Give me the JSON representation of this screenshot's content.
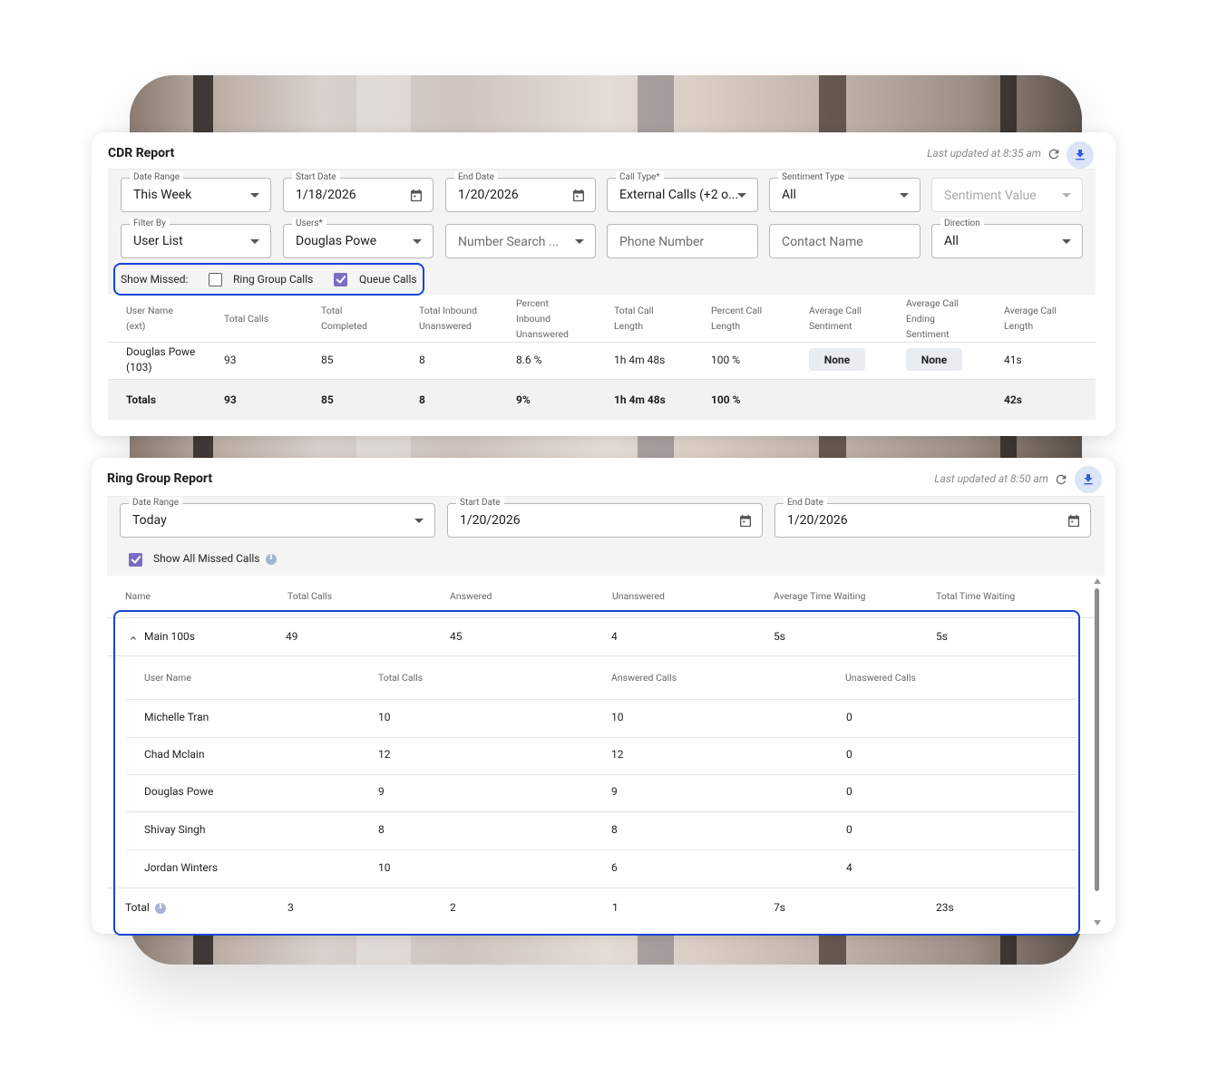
{
  "cdr": {
    "title": "CDR Report",
    "last_updated": "Last updated at 8:35 am",
    "filters": {
      "date_range": {
        "label": "Date Range",
        "value": "This Week"
      },
      "start_date": {
        "label": "Start Date",
        "value": "1/18/2026"
      },
      "end_date": {
        "label": "End Date",
        "value": "1/20/2026"
      },
      "call_type": {
        "label": "Call Type*",
        "value": "External Calls (+2 o..."
      },
      "sentiment_type": {
        "label": "Sentiment Type",
        "value": "All"
      },
      "sentiment_value": {
        "placeholder": "Sentiment Value"
      },
      "filter_by": {
        "label": "Filter By",
        "value": "User List"
      },
      "users": {
        "label": "Users*",
        "value": "Douglas Powe"
      },
      "number_search": {
        "placeholder": "Number Search ..."
      },
      "phone_number": {
        "placeholder": "Phone Number"
      },
      "contact_name": {
        "placeholder": "Contact Name"
      },
      "direction": {
        "label": "Direction",
        "value": "All"
      }
    },
    "show_missed": {
      "label": "Show Missed:",
      "ring_group_calls": {
        "label": "Ring Group Calls",
        "checked": false
      },
      "queue_calls": {
        "label": "Queue Calls",
        "checked": true
      }
    },
    "columns": [
      [
        "User Name",
        "(ext)"
      ],
      [
        "Total Calls"
      ],
      [
        "Total",
        "Completed"
      ],
      [
        "Total Inbound",
        "Unanswered"
      ],
      [
        "Percent",
        "Inbound",
        "Unanswered"
      ],
      [
        "Total Call",
        "Length"
      ],
      [
        "Percent Call",
        "Length"
      ],
      [
        "Average Call",
        "Sentiment"
      ],
      [
        "Average Call",
        "Ending",
        "Sentiment"
      ],
      [
        "Average Call",
        "Length"
      ]
    ],
    "row": {
      "user_name": "Douglas Powe",
      "ext": "(103)",
      "total_calls": "93",
      "total_completed": "85",
      "inbound_unanswered": "8",
      "percent_inbound_unanswered": "8.6 %",
      "total_call_length": "1h 4m 48s",
      "percent_call_length": "100 %",
      "avg_sentiment": "None",
      "avg_ending_sentiment": "None",
      "avg_call_length": "41s"
    },
    "totals": {
      "label": "Totals",
      "total_calls": "93",
      "total_completed": "85",
      "inbound_unanswered": "8",
      "percent_inbound_unanswered": "9%",
      "total_call_length": "1h 4m 48s",
      "percent_call_length": "100 %",
      "avg_call_length": "42s"
    }
  },
  "ring_group": {
    "title": "Ring Group Report",
    "last_updated": "Last updated at 8:50 am",
    "filters": {
      "date_range": {
        "label": "Date Range",
        "value": "Today"
      },
      "start_date": {
        "label": "Start Date",
        "value": "1/20/2026"
      },
      "end_date": {
        "label": "End Date",
        "value": "1/20/2026"
      }
    },
    "show_all_missed": {
      "label": "Show All Missed Calls",
      "checked": true
    },
    "columns": [
      "Name",
      "Total Calls",
      "Answered",
      "Unanswered",
      "Average Time Waiting",
      "Total Time Waiting"
    ],
    "group": {
      "name": "Main 100s",
      "total_calls": "49",
      "answered": "45",
      "unanswered": "4",
      "avg_wait": "5s",
      "total_wait": "5s"
    },
    "sub_columns": [
      "User Name",
      "Total Calls",
      "Answered Calls",
      "Unaswered Calls"
    ],
    "members": [
      {
        "name": "Michelle Tran",
        "total": "10",
        "answered": "10",
        "unanswered": "0"
      },
      {
        "name": "Chad Mclain",
        "total": "12",
        "answered": "12",
        "unanswered": "0"
      },
      {
        "name": "Douglas Powe",
        "total": "9",
        "answered": "9",
        "unanswered": "0"
      },
      {
        "name": "Shivay Singh",
        "total": "8",
        "answered": "8",
        "unanswered": "0"
      },
      {
        "name": "Jordan Winters",
        "total": "10",
        "answered": "6",
        "unanswered": "4"
      }
    ],
    "total": {
      "label": "Total",
      "total_calls": "3",
      "answered": "2",
      "unanswered": "1",
      "avg_wait": "7s",
      "total_wait": "23s"
    }
  },
  "colors": {
    "highlight": "#1745d6",
    "checkbox_checked": "#7a6cc4",
    "download_bg": "#dce4f7",
    "download_icon": "#3461d8"
  }
}
